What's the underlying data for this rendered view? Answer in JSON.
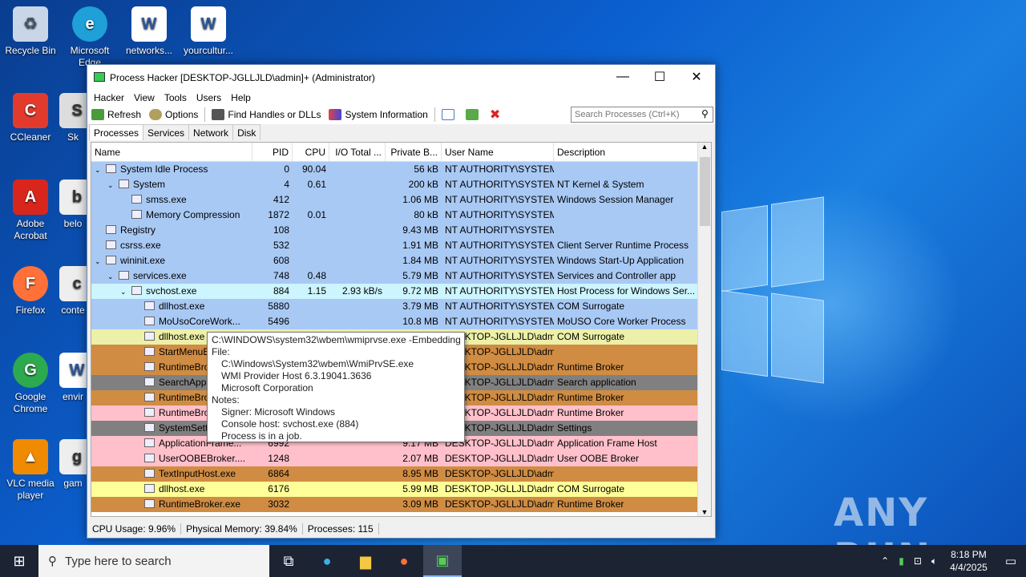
{
  "desktop": {
    "icons": [
      {
        "label": "Recycle Bin",
        "icon": "recycle-bin-icon"
      },
      {
        "label": "Microsoft Edge",
        "icon": "edge-icon"
      },
      {
        "label": "networks...",
        "icon": "word-doc-icon"
      },
      {
        "label": "yourcultur...",
        "icon": "word-doc-icon"
      },
      {
        "label": "CCleaner",
        "icon": "ccleaner-icon"
      },
      {
        "label": "Sk",
        "icon": "shortcut-icon"
      },
      {
        "label": "Adobe Acrobat",
        "icon": "acrobat-icon"
      },
      {
        "label": "belo",
        "icon": "shortcut-icon"
      },
      {
        "label": "Firefox",
        "icon": "firefox-icon"
      },
      {
        "label": "conte",
        "icon": "shortcut-icon"
      },
      {
        "label": "Google Chrome",
        "icon": "chrome-icon"
      },
      {
        "label": "envir",
        "icon": "word-doc-icon"
      },
      {
        "label": "VLC media player",
        "icon": "vlc-icon"
      },
      {
        "label": "gam",
        "icon": "shortcut-icon"
      }
    ],
    "watermark": "ANY RUN"
  },
  "window": {
    "title": "Process Hacker [DESKTOP-JGLLJLD\\admin]+ (Administrator)",
    "menu": [
      "Hacker",
      "View",
      "Tools",
      "Users",
      "Help"
    ],
    "toolbar": {
      "refresh": "Refresh",
      "options": "Options",
      "find_handles": "Find Handles or DLLs",
      "system_info": "System Information"
    },
    "search_placeholder": "Search Processes (Ctrl+K)",
    "tabs": [
      "Processes",
      "Services",
      "Network",
      "Disk"
    ],
    "columns": [
      "Name",
      "PID",
      "CPU",
      "I/O Total ...",
      "Private B...",
      "User Name",
      "Description"
    ],
    "rows": [
      {
        "name": "System Idle Process",
        "pid": "0",
        "cpu": "90.04",
        "io": "",
        "priv": "56 kB",
        "user": "NT AUTHORITY\\SYSTEM",
        "desc": "",
        "level": 0,
        "tree": "v",
        "color": "#a9c9f5"
      },
      {
        "name": "System",
        "pid": "4",
        "cpu": "0.61",
        "io": "",
        "priv": "200 kB",
        "user": "NT AUTHORITY\\SYSTEM",
        "desc": "NT Kernel & System",
        "level": 1,
        "tree": "v",
        "color": "#a9c9f5"
      },
      {
        "name": "smss.exe",
        "pid": "412",
        "cpu": "",
        "io": "",
        "priv": "1.06 MB",
        "user": "NT AUTHORITY\\SYSTEM",
        "desc": "Windows Session Manager",
        "level": 2,
        "tree": "",
        "color": "#a9c9f5"
      },
      {
        "name": "Memory Compression",
        "pid": "1872",
        "cpu": "0.01",
        "io": "",
        "priv": "80 kB",
        "user": "NT AUTHORITY\\SYSTEM",
        "desc": "",
        "level": 2,
        "tree": "",
        "color": "#a9c9f5"
      },
      {
        "name": "Registry",
        "pid": "108",
        "cpu": "",
        "io": "",
        "priv": "9.43 MB",
        "user": "NT AUTHORITY\\SYSTEM",
        "desc": "",
        "level": 0,
        "tree": "",
        "color": "#a9c9f5"
      },
      {
        "name": "csrss.exe",
        "pid": "532",
        "cpu": "",
        "io": "",
        "priv": "1.91 MB",
        "user": "NT AUTHORITY\\SYSTEM",
        "desc": "Client Server Runtime Process",
        "level": 0,
        "tree": "",
        "color": "#a9c9f5"
      },
      {
        "name": "wininit.exe",
        "pid": "608",
        "cpu": "",
        "io": "",
        "priv": "1.84 MB",
        "user": "NT AUTHORITY\\SYSTEM",
        "desc": "Windows Start-Up Application",
        "level": 0,
        "tree": "v",
        "color": "#a9c9f5"
      },
      {
        "name": "services.exe",
        "pid": "748",
        "cpu": "0.48",
        "io": "",
        "priv": "5.79 MB",
        "user": "NT AUTHORITY\\SYSTEM",
        "desc": "Services and Controller app",
        "level": 1,
        "tree": "v",
        "color": "#a9c9f5"
      },
      {
        "name": "svchost.exe",
        "pid": "884",
        "cpu": "1.15",
        "io": "2.93 kB/s",
        "priv": "9.72 MB",
        "user": "NT AUTHORITY\\SYSTEM",
        "desc": "Host Process for Windows Ser...",
        "level": 2,
        "tree": "v",
        "color": "#ccf5ff"
      },
      {
        "name": "dllhost.exe",
        "pid": "5880",
        "cpu": "",
        "io": "",
        "priv": "3.79 MB",
        "user": "NT AUTHORITY\\SYSTEM",
        "desc": "COM Surrogate",
        "level": 3,
        "tree": "",
        "color": "#a9c9f5"
      },
      {
        "name": "MoUsoCoreWork...",
        "pid": "5496",
        "cpu": "",
        "io": "",
        "priv": "10.8 MB",
        "user": "NT AUTHORITY\\SYSTEM",
        "desc": "MoUSO Core Worker Process",
        "level": 3,
        "tree": "",
        "color": "#a9c9f5"
      },
      {
        "name": "dllhost.exe",
        "pid": "",
        "cpu": "",
        "io": "",
        "priv": "",
        "user": "DESKTOP-JGLLJLD\\admi",
        "desc": "COM Surrogate",
        "level": 3,
        "tree": "",
        "color": "#ecf0a8"
      },
      {
        "name": "StartMenuExperi...",
        "pid": "",
        "cpu": "",
        "io": "",
        "priv": "",
        "user": "DESKTOP-JGLLJLD\\admi",
        "desc": "",
        "level": 3,
        "tree": "",
        "color": "#d08c42"
      },
      {
        "name": "RuntimeBroker.exe",
        "pid": "",
        "cpu": "",
        "io": "",
        "priv": "",
        "user": "DESKTOP-JGLLJLD\\admi",
        "desc": "Runtime Broker",
        "level": 3,
        "tree": "",
        "color": "#d08c42"
      },
      {
        "name": "SearchApp.exe",
        "pid": "",
        "cpu": "",
        "io": "",
        "priv": "",
        "user": "DESKTOP-JGLLJLD\\admi",
        "desc": "Search application",
        "level": 3,
        "tree": "",
        "color": "#808080"
      },
      {
        "name": "RuntimeBroker.exe",
        "pid": "",
        "cpu": "",
        "io": "",
        "priv": "",
        "user": "DESKTOP-JGLLJLD\\admi",
        "desc": "Runtime Broker",
        "level": 3,
        "tree": "",
        "color": "#d08c42"
      },
      {
        "name": "RuntimeBroker.exe",
        "pid": "",
        "cpu": "",
        "io": "",
        "priv": "",
        "user": "DESKTOP-JGLLJLD\\admi",
        "desc": "Runtime Broker",
        "level": 3,
        "tree": "",
        "color": "#ffc0cb"
      },
      {
        "name": "SystemSettings.exe",
        "pid": "",
        "cpu": "",
        "io": "",
        "priv": "",
        "user": "DESKTOP-JGLLJLD\\admi",
        "desc": "Settings",
        "level": 3,
        "tree": "",
        "color": "#808080"
      },
      {
        "name": "ApplicationFrame...",
        "pid": "6992",
        "cpu": "",
        "io": "",
        "priv": "9.17 MB",
        "user": "DESKTOP-JGLLJLD\\admi",
        "desc": "Application Frame Host",
        "level": 3,
        "tree": "",
        "color": "#ffc0cb"
      },
      {
        "name": "UserOOBEBroker....",
        "pid": "1248",
        "cpu": "",
        "io": "",
        "priv": "2.07 MB",
        "user": "DESKTOP-JGLLJLD\\admi",
        "desc": "User OOBE Broker",
        "level": 3,
        "tree": "",
        "color": "#ffc0cb"
      },
      {
        "name": "TextInputHost.exe",
        "pid": "6864",
        "cpu": "",
        "io": "",
        "priv": "8.95 MB",
        "user": "DESKTOP-JGLLJLD\\admi",
        "desc": "",
        "level": 3,
        "tree": "",
        "color": "#d08c42"
      },
      {
        "name": "dllhost.exe",
        "pid": "6176",
        "cpu": "",
        "io": "",
        "priv": "5.99 MB",
        "user": "DESKTOP-JGLLJLD\\admi",
        "desc": "COM Surrogate",
        "level": 3,
        "tree": "",
        "color": "#ffff99"
      },
      {
        "name": "RuntimeBroker.exe",
        "pid": "3032",
        "cpu": "",
        "io": "",
        "priv": "3.09 MB",
        "user": "DESKTOP-JGLLJLD\\admi",
        "desc": "Runtime Broker",
        "level": 3,
        "tree": "",
        "color": "#d08c42"
      }
    ],
    "tooltip": [
      {
        "text": "C:\\WINDOWS\\system32\\wbem\\wmiprvse.exe -Embedding",
        "indent": false
      },
      {
        "text": "File:",
        "indent": false
      },
      {
        "text": "C:\\Windows\\System32\\wbem\\WmiPrvSE.exe",
        "indent": true
      },
      {
        "text": "WMI Provider Host 6.3.19041.3636",
        "indent": true
      },
      {
        "text": "Microsoft Corporation",
        "indent": true
      },
      {
        "text": "Notes:",
        "indent": false
      },
      {
        "text": "Signer: Microsoft Windows",
        "indent": true
      },
      {
        "text": "Console host: svchost.exe (884)",
        "indent": true
      },
      {
        "text": "Process is in a job.",
        "indent": true
      }
    ],
    "status": {
      "cpu": "CPU Usage: 9.96%",
      "memory": "Physical Memory: 39.84%",
      "processes": "Processes: 115"
    }
  },
  "taskbar": {
    "search_placeholder": "Type here to search",
    "time": "8:18 PM",
    "date": "4/4/2025"
  }
}
